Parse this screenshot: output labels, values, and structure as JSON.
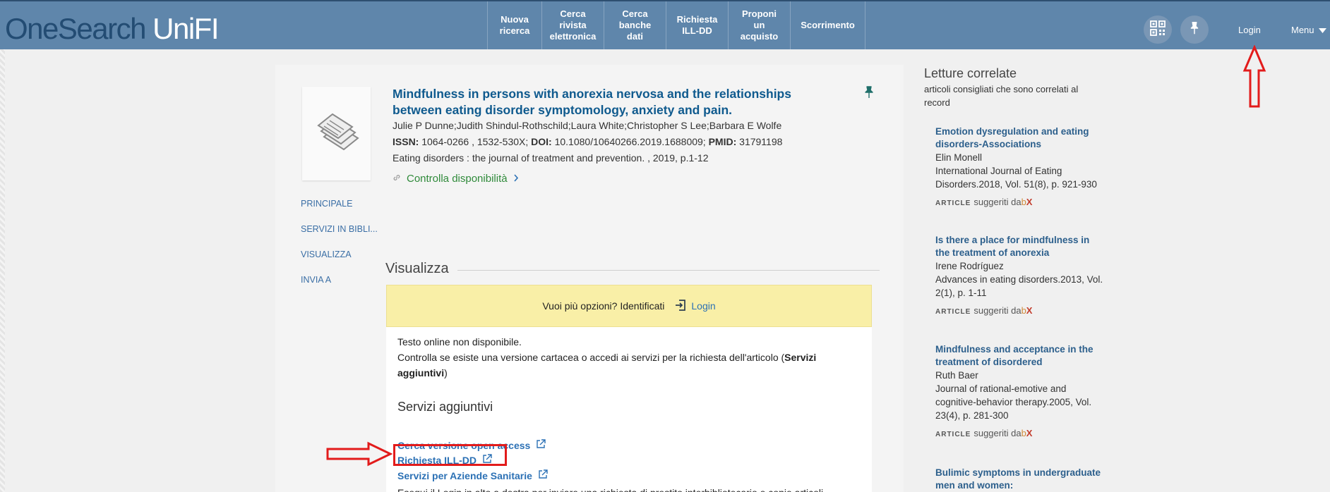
{
  "header": {
    "logo_part1": "OneSearch",
    "logo_part2": "UniFI",
    "nav": [
      {
        "label": "Nuova\nricerca"
      },
      {
        "label": "Cerca\nrivista\nelettronica"
      },
      {
        "label": "Cerca\nbanche\ndati"
      },
      {
        "label": "Richiesta\nILL-DD"
      },
      {
        "label": "Proponi\nun\nacquisto"
      },
      {
        "label": "Scorrimento"
      }
    ],
    "qr_icon": "qr-code-icon",
    "pin_icon": "pin-icon",
    "login_label": "Login",
    "menu_label": "Menu"
  },
  "record": {
    "title": "Mindfulness in persons with anorexia nervosa and the relationships between eating disorder symptomology, anxiety and pain.",
    "authors": "Julie P Dunne;Judith Shindul-Rothschild;Laura White;Christopher S Lee;Barbara E Wolfe",
    "issn_label": "ISSN:",
    "issn_value": "1064-0266 , 1532-530X;",
    "doi_label": "DOI:",
    "doi_value": "10.1080/10640266.2019.1688009;",
    "pmid_label": "PMID:",
    "pmid_value": "31791198",
    "source": "Eating disorders : the journal of treatment and prevention. , 2019, p.1-12",
    "availability": "Controlla disponibilità"
  },
  "side_menu": [
    {
      "label": "PRINCIPALE"
    },
    {
      "label": "SERVIZI IN BIBLI..."
    },
    {
      "label": "VISUALIZZA"
    },
    {
      "label": "INVIA A"
    }
  ],
  "view": {
    "section_title": "Visualizza",
    "banner_text": "Vuoi più opzioni? Identificati",
    "banner_login": "Login",
    "line1": "Testo online non disponibile.",
    "line2_a": "Controlla se esiste una versione cartacea o accedi ai servizi per la richiesta dell'articolo (",
    "line2_bold_a": "Servizi",
    "line3_bold": "aggiuntivi",
    "line3_b": ")",
    "services_title": "Servizi aggiuntivi",
    "services": [
      {
        "label": "Cerca versione open access"
      },
      {
        "label": "Richiesta ILL-DD"
      },
      {
        "label": "Servizi per Aziende Sanitarie"
      }
    ],
    "footer_text": "Esegui il Login in alto a destra per inviare una richiesta di prestito interbibliotecario e copie articoli"
  },
  "related": {
    "title": "Letture correlate",
    "subtitle": "articoli consigliati che sono correlati al record",
    "foot_type": "ARTICLE",
    "foot_text": "suggeriti da",
    "foot_logo_b": "b",
    "foot_logo_x": "X",
    "items": [
      {
        "title": "Emotion dysregulation and eating disorders-Associations",
        "author": "Elin Monell",
        "source": "International Journal of Eating Disorders.2018, Vol. 51(8), p. 921-930"
      },
      {
        "title": "Is there a place for mindfulness in the treatment of anorexia",
        "author": "Irene Rodríguez",
        "source": "Advances in eating disorders.2013, Vol. 2(1), p. 1-11"
      },
      {
        "title": "Mindfulness and acceptance in the treatment of disordered",
        "author": "Ruth Baer",
        "source": "Journal of rational-emotive and cognitive-behavior therapy.2005, Vol. 23(4), p. 281-300"
      },
      {
        "title": "Bulimic symptoms in undergraduate men and women:",
        "author": "",
        "source": ""
      }
    ]
  },
  "colors": {
    "header_bg": "#5f86ab",
    "link": "#2c71b5",
    "title": "#0f5a8e",
    "available": "#2f8a3a",
    "banner": "#f9efa7",
    "annotation": "#e21b1b"
  }
}
